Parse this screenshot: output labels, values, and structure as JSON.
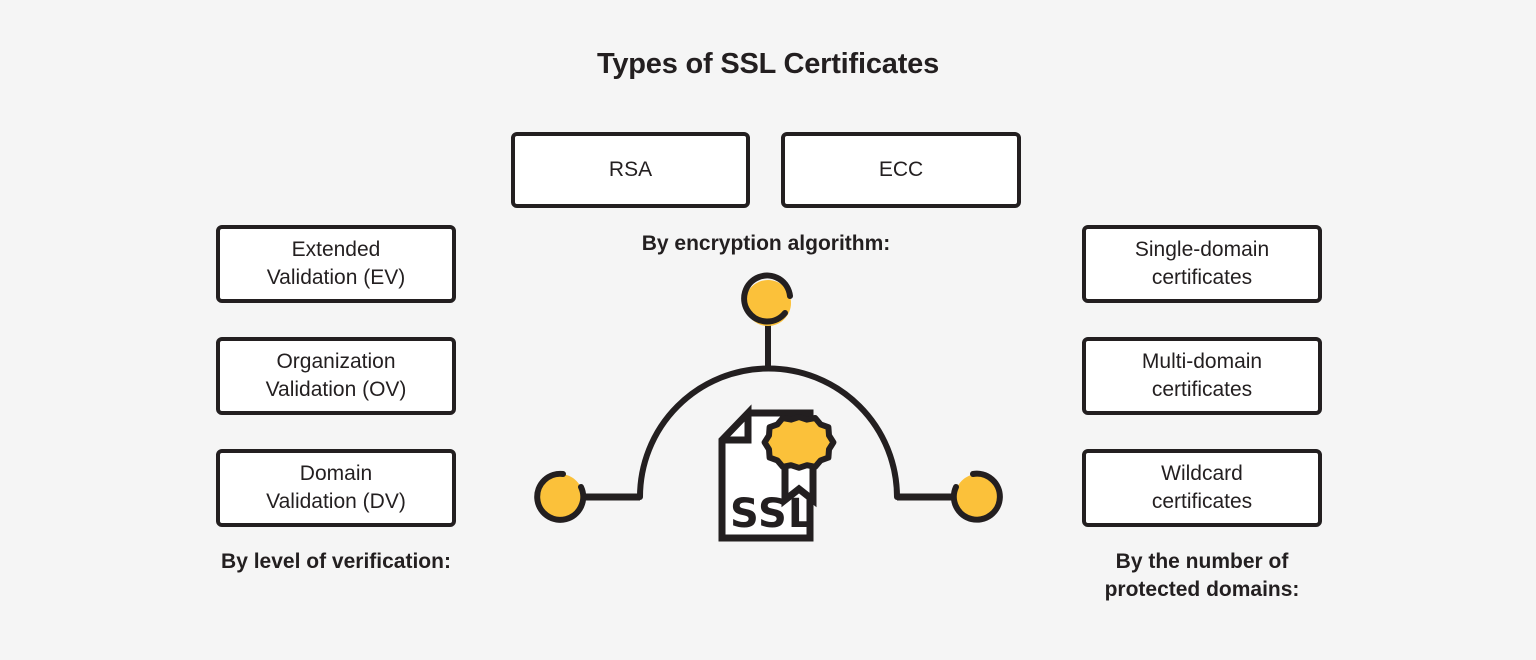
{
  "title": "Types of SSL Certificates",
  "colors": {
    "background": "#f5f5f5",
    "ink": "#231f20",
    "accent_yellow": "#fbc13a",
    "box_fill": "#ffffff"
  },
  "groups": {
    "encryption": {
      "caption": "By encryption algorithm:",
      "items": [
        {
          "label": "RSA"
        },
        {
          "label": "ECC"
        }
      ]
    },
    "verification": {
      "caption": "By level of verification:",
      "items": [
        {
          "label": "Extended\nValidation (EV)"
        },
        {
          "label": "Organization\nValidation (OV)"
        },
        {
          "label": "Domain\nValidation (DV)"
        }
      ]
    },
    "domains": {
      "caption": "By the number of\nprotected domains:",
      "items": [
        {
          "label": "Single-domain\ncertificates"
        },
        {
          "label": "Multi-domain\ncertificates"
        },
        {
          "label": "Wildcard\ncertificates"
        }
      ]
    }
  },
  "illustration": {
    "document_label": "SSL",
    "nodes": [
      {
        "name": "top-node"
      },
      {
        "name": "left-node"
      },
      {
        "name": "right-node"
      }
    ]
  }
}
